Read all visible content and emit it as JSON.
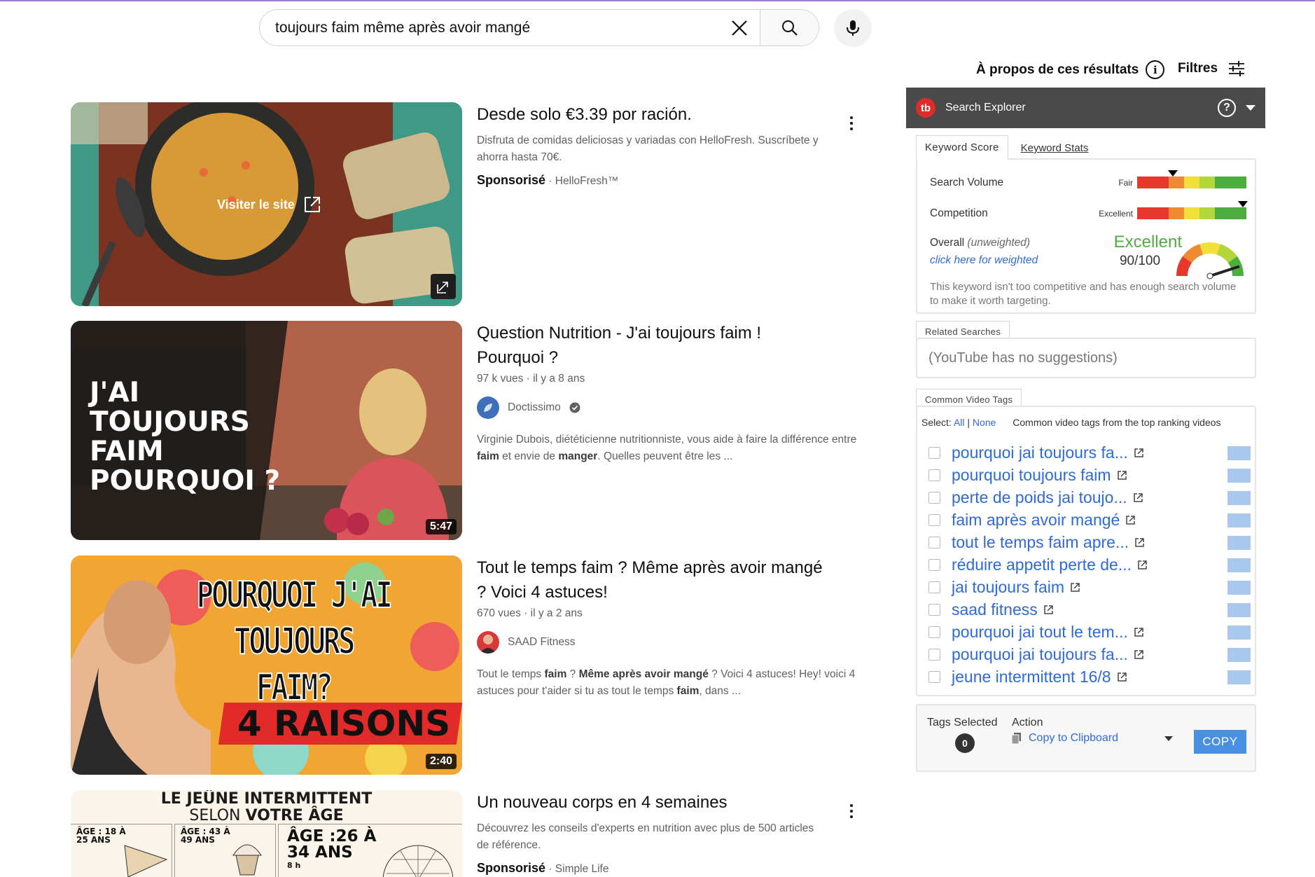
{
  "search": {
    "query": "toujours faim même après avoir mangé"
  },
  "header": {
    "about_label": "À propos de ces résultats",
    "filters_label": "Filtres"
  },
  "results": [
    {
      "title": "Desde solo €3.39 por ración.",
      "description": "Disfruta de comidas deliciosas y variadas con HelloFresh. Suscríbete y ahorra hasta 70€.",
      "sponsored_label": "Sponsorisé",
      "advertiser": "· HelloFresh™",
      "visit_label": "Visiter le site"
    },
    {
      "title": "Question Nutrition - J'ai toujours faim ! Pourquoi ?",
      "meta": "97 k vues · il y a 8 ans",
      "channel": "Doctissimo",
      "desc_parts": [
        "Virginie Dubois, diététicienne nutritionniste, vous aide à faire la différence entre ",
        "faim",
        " et envie de ",
        "manger",
        ". Quelles peuvent être les ..."
      ],
      "duration": "5:47",
      "thumb_text": [
        "J'AI",
        "TOUJOURS",
        "FAIM",
        "POURQUOI ?"
      ]
    },
    {
      "title": "Tout le temps faim ? Même après avoir mangé ? Voici 4 astuces!",
      "meta": "670 vues · il y a 2 ans",
      "channel": "SAAD Fitness",
      "desc_parts": [
        "Tout le temps ",
        "faim",
        " ? ",
        "Même après avoir mangé",
        " ? Voici 4 astuces! Hey! voici 4 astuces pour t'aider si tu as tout le temps ",
        "faim",
        ", dans ..."
      ],
      "duration": "2:40",
      "thumb_text": [
        "POURQUOI J'AI",
        "TOUJOURS FAIM?",
        "4 RAISONS"
      ]
    },
    {
      "title": "Un nouveau corps en 4 semaines",
      "description": "Découvrez les conseils d'experts en nutrition avec plus de 500 articles de référence.",
      "sponsored_label": "Sponsorisé",
      "advertiser": "· Simple Life",
      "thumb_text": [
        "LE JEÛNE INTERMITTENT",
        "SELON",
        "VOTRE ÂGE",
        "ÂGE : 18 À",
        "25 ANS",
        "ÂGE : 43 À",
        "49 ANS",
        "ÂGE :26 À",
        "34 ANS",
        "8 h"
      ]
    }
  ],
  "extension": {
    "title": "Search Explorer",
    "logo_text": "tb",
    "tabs": [
      "Keyword Score",
      "Keyword Stats"
    ],
    "search_volume": {
      "label": "Search Volume",
      "rating": "Fair",
      "level": 0.33
    },
    "competition": {
      "label": "Competition",
      "rating": "Excellent",
      "level": 0.97
    },
    "overall": {
      "label": "Overall",
      "label_note": "(unweighted)",
      "link": "click here for weighted",
      "rating": "Excellent",
      "score": "90/100",
      "gauge_level": 0.9
    },
    "explanation": "This keyword isn't too competitive and has enough search volume to make it worth targeting.",
    "related": {
      "label": "Related Searches",
      "empty": "(YouTube has no suggestions)"
    },
    "tags": {
      "label": "Common Video Tags",
      "select_label": "Select:",
      "all": "All",
      "sep": "|",
      "none": "None",
      "note": "Common video tags from the top ranking videos",
      "items": [
        "pourquoi jai toujours fa...",
        "pourquoi toujours faim",
        "perte de poids jai toujo...",
        "faim après avoir mangé",
        "tout le temps faim apre...",
        "réduire appetit perte de...",
        "jai toujours faim",
        "saad fitness",
        "pourquoi jai tout le tem...",
        "pourquoi jai toujours fa...",
        "jeune intermittent 16/8"
      ]
    },
    "action": {
      "tags_selected_label": "Tags Selected",
      "count": "0",
      "action_label": "Action",
      "action_value": "Copy to Clipboard",
      "copy_label": "COPY"
    },
    "colors": {
      "red": "#e8372c",
      "orange": "#ee8b30",
      "yellow": "#f2df3a",
      "yellowgreen": "#b3d63a",
      "green": "#4cae3e",
      "link": "#2f6bd1",
      "excellent": "#4cae3e"
    }
  }
}
